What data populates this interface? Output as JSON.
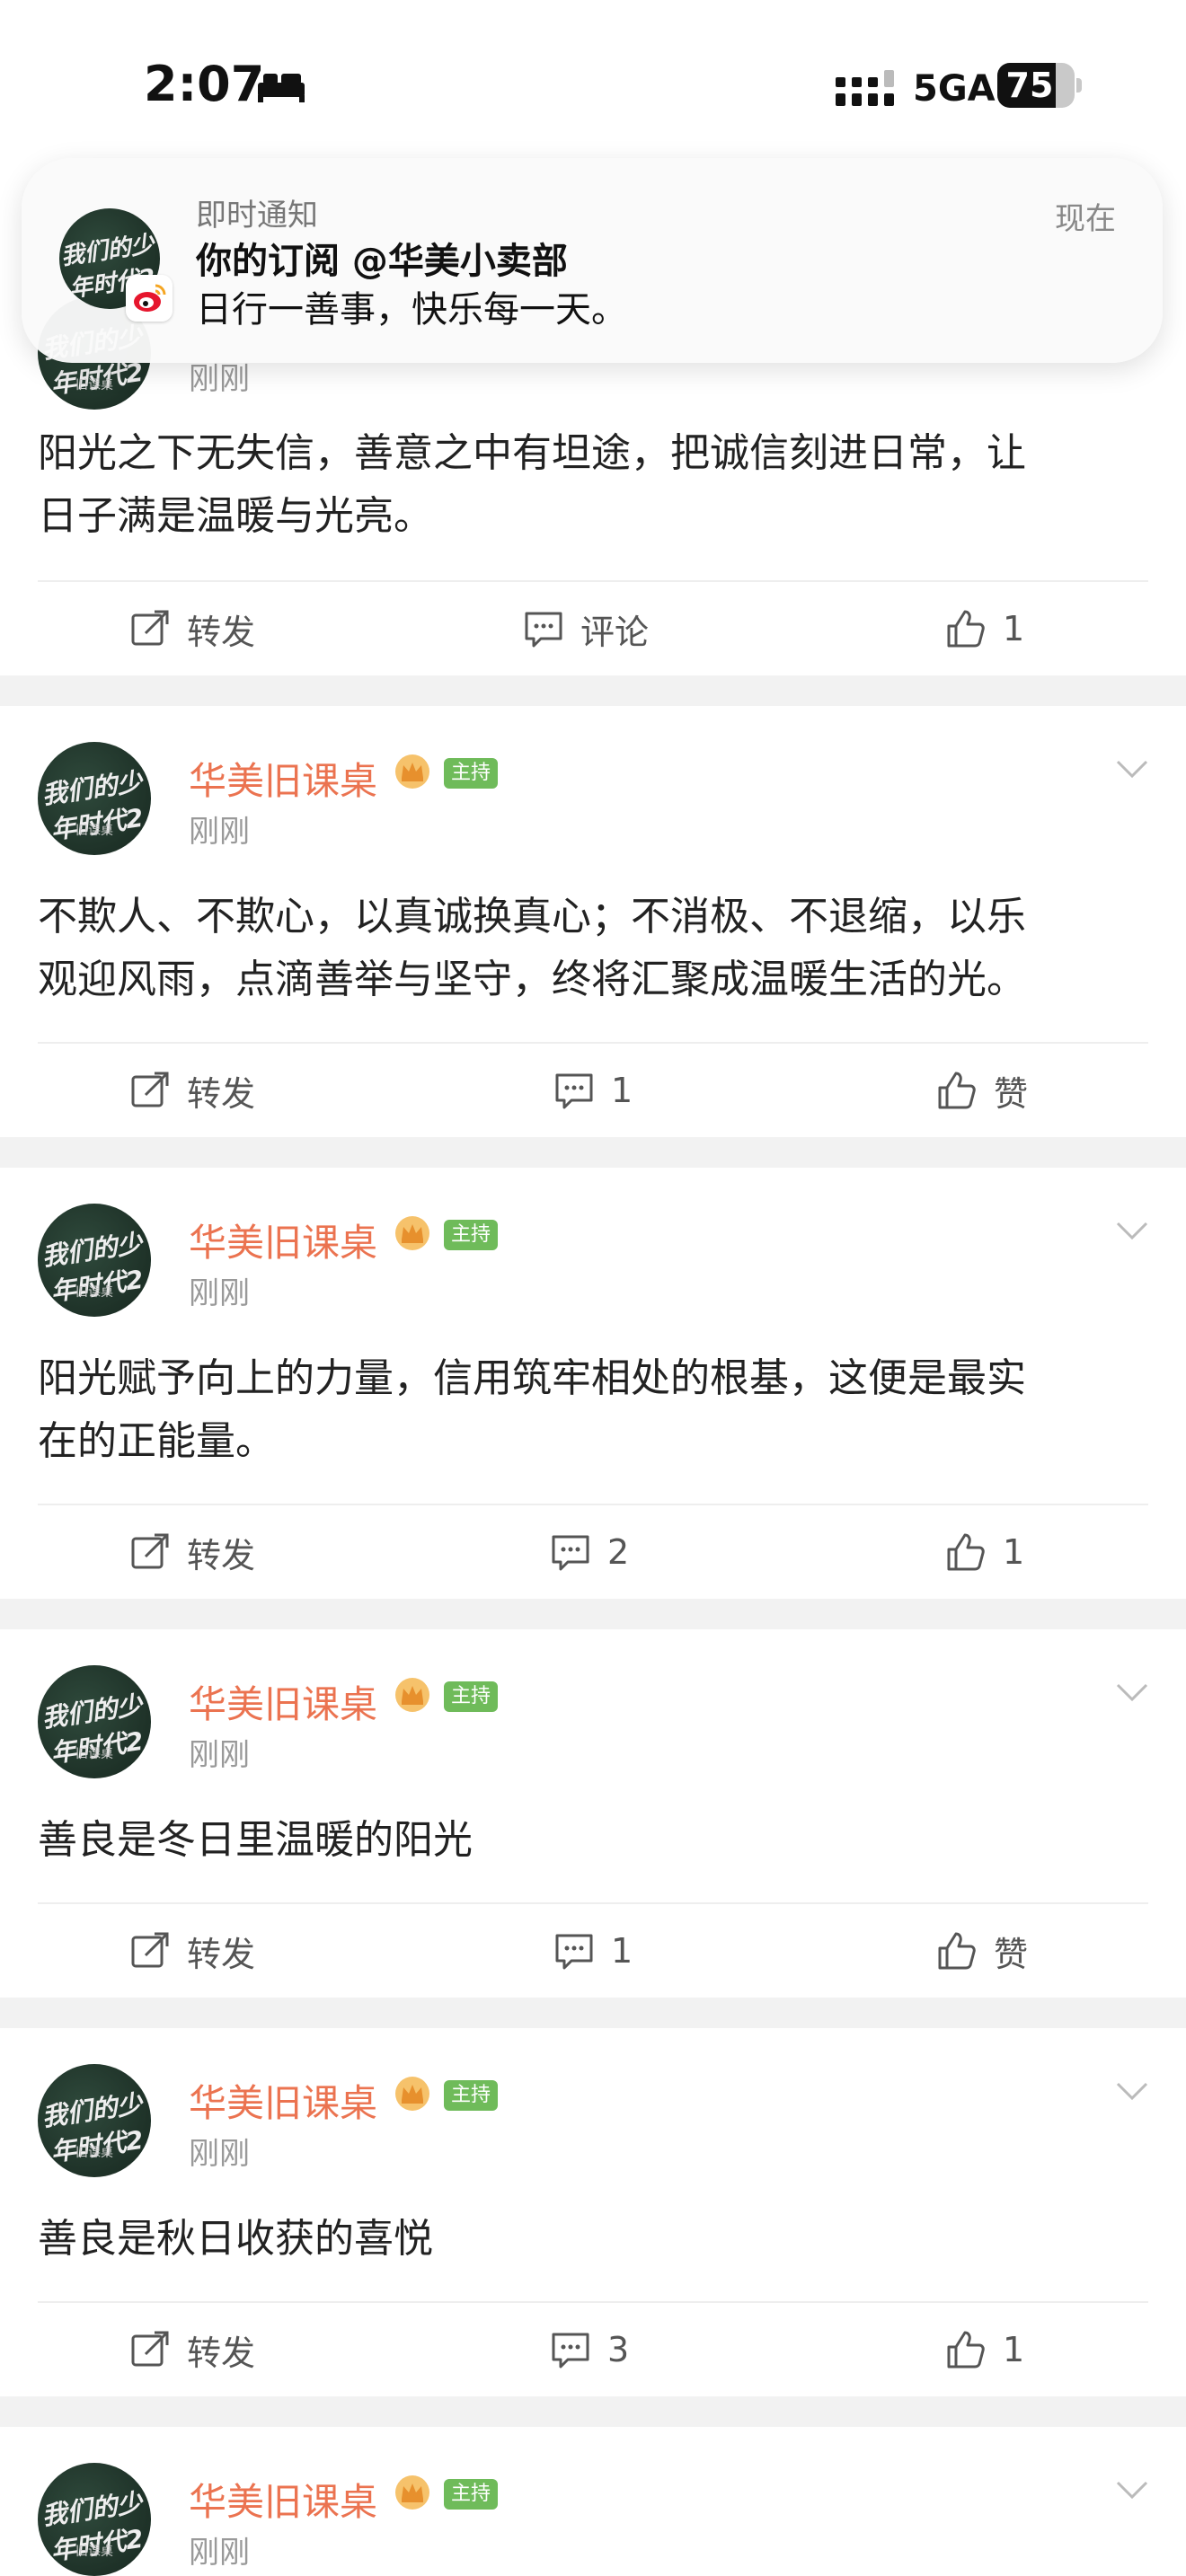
{
  "status": {
    "time": "2:07",
    "network": "5GA",
    "battery": "75",
    "battery_level": 0.75
  },
  "banner": {
    "app": "即时通知",
    "title": "你的订阅 @华美小卖部",
    "body": "日行一善事，快乐每一天。",
    "time": "现在",
    "avatar_text": "我们的少年时代2"
  },
  "author": {
    "name": "华美旧课桌",
    "badge": "主持",
    "avatar_text": "我们的少年时代2",
    "avatar_sub": "旧课桌"
  },
  "posts": [
    {
      "time": "刚刚",
      "line1": "阳光之下无失信，善意之中有坦途，把诚信刻进日常，让",
      "line2": "日子满是温暖与光亮。",
      "repost": "转发",
      "comment": "评论",
      "like": "1"
    },
    {
      "time": "刚刚",
      "line1": "不欺人、不欺心，以真诚换真心；不消极、不退缩，以乐",
      "line2": "观迎风雨，点滴善举与坚守，终将汇聚成温暖生活的光。",
      "repost": "转发",
      "comment": "1",
      "like": "赞"
    },
    {
      "time": "刚刚",
      "line1": "阳光赋予向上的力量，信用筑牢相处的根基，这便是最实",
      "line2": "在的正能量。",
      "repost": "转发",
      "comment": "2",
      "like": "1"
    },
    {
      "time": "刚刚",
      "line1": "善良是冬日里温暖的阳光",
      "line2": "",
      "repost": "转发",
      "comment": "1",
      "like": "赞"
    },
    {
      "time": "刚刚",
      "line1": "善良是秋日收获的喜悦",
      "line2": "",
      "repost": "转发",
      "comment": "3",
      "like": "1"
    },
    {
      "time": "刚刚"
    }
  ]
}
